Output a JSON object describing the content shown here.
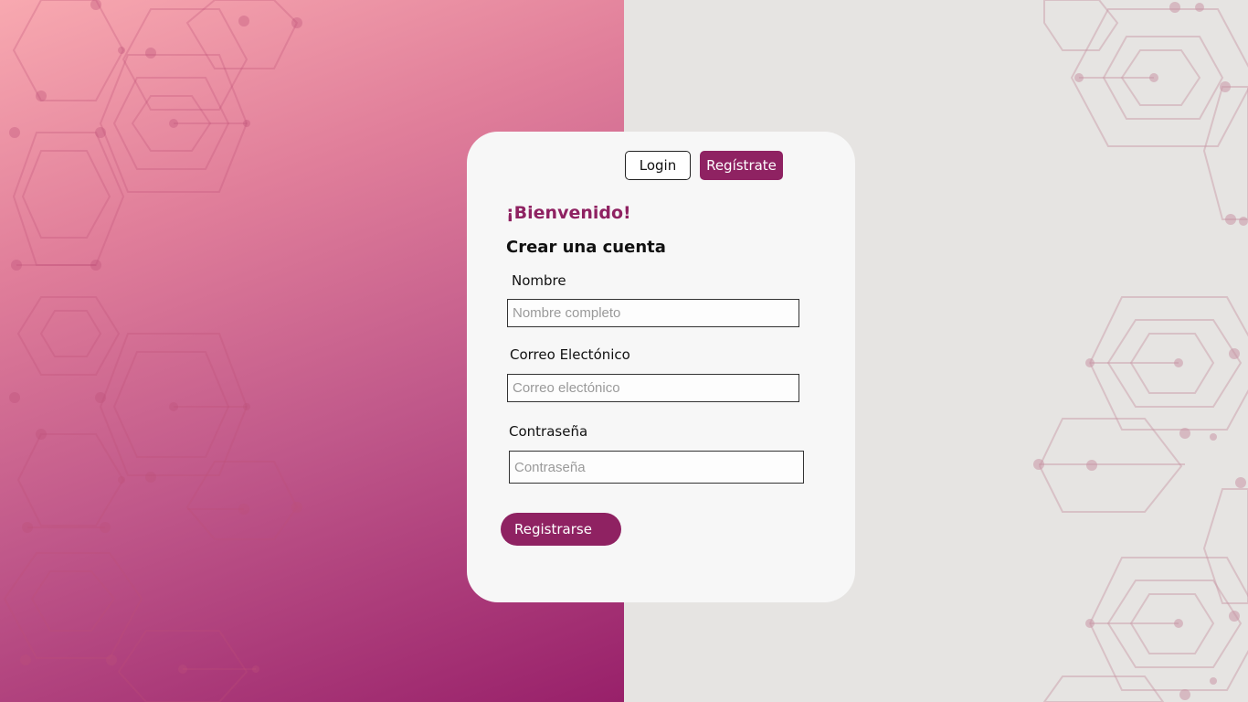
{
  "nav": {
    "login_label": "Login",
    "register_label": "Regístrate"
  },
  "form": {
    "welcome": "¡Bienvenido!",
    "heading": "Crear una cuenta",
    "name": {
      "label": "Nombre",
      "placeholder": "Nombre completo"
    },
    "email": {
      "label": "Correo Electónico",
      "placeholder": "Correo electónico"
    },
    "password": {
      "label": "Contraseña",
      "placeholder": "Contraseña"
    },
    "submit_label": "Registrarse"
  },
  "colors": {
    "accent": "#8f2262",
    "gradient_start": "#f8a9b0",
    "gradient_end": "#98206a",
    "right_background": "#e6e4e2",
    "card_background": "#f7f7f7"
  }
}
